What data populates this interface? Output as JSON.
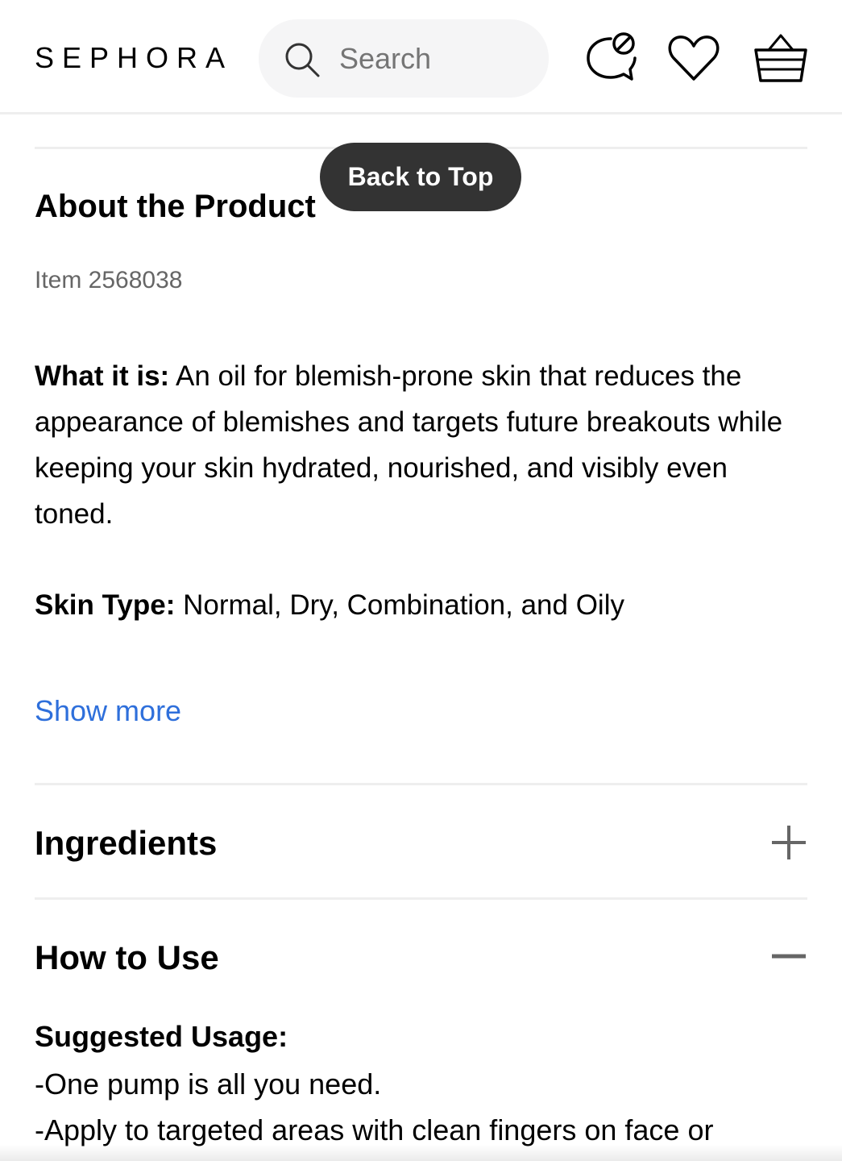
{
  "header": {
    "logo": "SEPHORA",
    "search_placeholder": "Search"
  },
  "back_to_top": "Back to Top",
  "about": {
    "title": "About the Product",
    "item_number": "Item 2568038",
    "what_it_is_label": "What it is:",
    "what_it_is_text": " An oil for blemish-prone skin that reduces the appearance of blemishes and targets future breakouts while keeping your skin hydrated, nourished, and visibly even toned.",
    "skin_type_label": "Skin Type:",
    "skin_type_text": " Normal, Dry, Combination, and Oily",
    "show_more": "Show more"
  },
  "ingredients": {
    "title": "Ingredients",
    "state": "collapsed"
  },
  "how_to_use": {
    "title": "How to Use",
    "state": "expanded",
    "suggested_usage_title": "Suggested Usage:",
    "lines": [
      "-One pump is all you need.",
      "-Apply to targeted areas with clean fingers on face or"
    ]
  },
  "colors": {
    "link": "#2e6fdb",
    "back_to_top_bg": "#333333",
    "search_bg": "#f5f5f6"
  }
}
